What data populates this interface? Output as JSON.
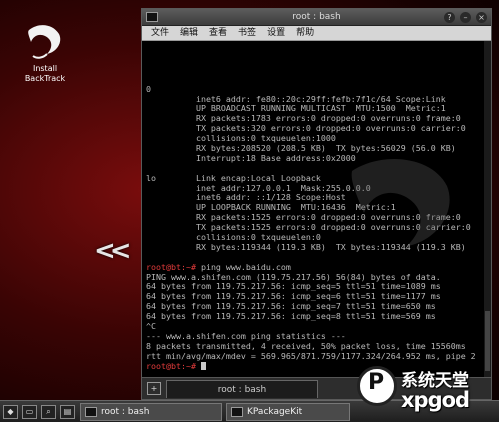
{
  "desktop": {
    "icon_label_line1": "Install",
    "icon_label_line2": "BackTrack",
    "chevrons": "<<"
  },
  "window": {
    "title": "root : bash",
    "menu": [
      "文件",
      "编辑",
      "查看",
      "书签",
      "设置",
      "帮助"
    ],
    "controls": [
      "?",
      "–",
      "×"
    ]
  },
  "terminal": {
    "lines": [
      {
        "text": "0"
      },
      {
        "text": "          inet6 addr: fe80::20c:29ff:fefb:7f1c/64 Scope:Link"
      },
      {
        "text": "          UP BROADCAST RUNNING MULTICAST  MTU:1500  Metric:1"
      },
      {
        "text": "          RX packets:1783 errors:0 dropped:0 overruns:0 frame:0"
      },
      {
        "text": "          TX packets:320 errors:0 dropped:0 overruns:0 carrier:0"
      },
      {
        "text": "          collisions:0 txqueuelen:1000"
      },
      {
        "text": "          RX bytes:208520 (208.5 KB)  TX bytes:56029 (56.0 KB)"
      },
      {
        "text": "          Interrupt:18 Base address:0x2000"
      },
      {
        "text": ""
      },
      {
        "text": "lo        Link encap:Local Loopback"
      },
      {
        "text": "          inet addr:127.0.0.1  Mask:255.0.0.0"
      },
      {
        "text": "          inet6 addr: ::1/128 Scope:Host"
      },
      {
        "text": "          UP LOOPBACK RUNNING  MTU:16436  Metric:1"
      },
      {
        "text": "          RX packets:1525 errors:0 dropped:0 overruns:0 frame:0"
      },
      {
        "text": "          TX packets:1525 errors:0 dropped:0 overruns:0 carrier:0"
      },
      {
        "text": "          collisions:0 txqueuelen:0"
      },
      {
        "text": "          RX bytes:119344 (119.3 KB)  TX bytes:119344 (119.3 KB)"
      },
      {
        "text": ""
      },
      {
        "prompt": "root@bt:~#",
        "text": " ping www.baidu.com"
      },
      {
        "text": "PING www.a.shifen.com (119.75.217.56) 56(84) bytes of data."
      },
      {
        "text": "64 bytes from 119.75.217.56: icmp_seq=5 ttl=51 time=1089 ms"
      },
      {
        "text": "64 bytes from 119.75.217.56: icmp_seq=6 ttl=51 time=1177 ms"
      },
      {
        "text": "64 bytes from 119.75.217.56: icmp_seq=7 ttl=51 time=650 ms"
      },
      {
        "text": "64 bytes from 119.75.217.56: icmp_seq=8 ttl=51 time=569 ms"
      },
      {
        "text": "^C"
      },
      {
        "text": "--- www.a.shifen.com ping statistics ---"
      },
      {
        "text": "8 packets transmitted, 4 received, 50% packet loss, time 15560ms"
      },
      {
        "text": "rtt min/avg/max/mdev = 569.965/871.759/1177.324/264.952 ms, pipe 2"
      },
      {
        "prompt": "root@bt:~#",
        "text": " ",
        "cursor": true
      }
    ]
  },
  "tab": {
    "label": "root : bash"
  },
  "taskbar": {
    "tasks": [
      "root : bash",
      "KPackageKit"
    ]
  },
  "watermark": {
    "circle_letter": "P",
    "cn_text": "系统天堂",
    "en_text": "xpgod"
  },
  "colors": {
    "prompt": "#e23b3b",
    "terminal_text": "#b9b9b9",
    "desktop_red": "#7a0d0d"
  },
  "icons": [
    "backtrack-dragon-icon",
    "kde-menu-icon",
    "terminal-icon",
    "search-icon"
  ]
}
